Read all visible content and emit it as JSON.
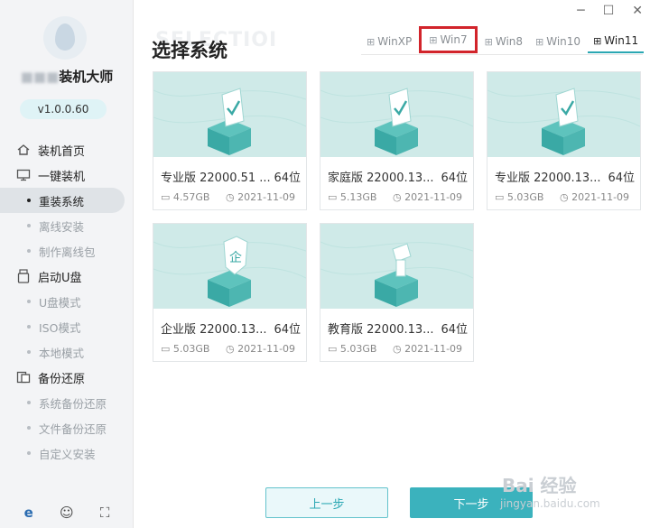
{
  "app": {
    "brand_blur": "■■■",
    "brand_name": "装机大师",
    "version": "v1.0.0.60"
  },
  "window_controls": {
    "minimize": "─",
    "maximize": "☐",
    "close": "✕"
  },
  "sidebar": {
    "groups": [
      {
        "label": "装机首页",
        "icon": "home-icon"
      },
      {
        "label": "一键装机",
        "icon": "monitor-icon"
      },
      {
        "label": "启动U盘",
        "icon": "usb-icon"
      },
      {
        "label": "备份还原",
        "icon": "backup-icon"
      }
    ],
    "sub_install": [
      "重装系统",
      "离线安装",
      "制作离线包"
    ],
    "sub_usb": [
      "U盘模式",
      "ISO模式",
      "本地模式"
    ],
    "sub_backup": [
      "系统备份还原",
      "文件备份还原",
      "自定义安装"
    ],
    "footer": [
      "e",
      "☺",
      "⛶"
    ]
  },
  "main": {
    "bg_word": "SELECTIOI",
    "title": "选择系统",
    "tabs": [
      "WinXP",
      "Win7",
      "Win8",
      "Win10",
      "Win11"
    ],
    "active_tab": "Win11",
    "highlight_tab": "Win7"
  },
  "cards": [
    {
      "name": "专业版 22000.51 ...",
      "bits": "64位",
      "size": "4.57GB",
      "date": "2021-11-09",
      "emblem": "check"
    },
    {
      "name": "家庭版 22000.13...",
      "bits": "64位",
      "size": "5.13GB",
      "date": "2021-11-09",
      "emblem": "check"
    },
    {
      "name": "专业版 22000.13...",
      "bits": "64位",
      "size": "5.03GB",
      "date": "2021-11-09",
      "emblem": "check"
    },
    {
      "name": "企业版 22000.13...",
      "bits": "64位",
      "size": "5.03GB",
      "date": "2021-11-09",
      "emblem": "企"
    },
    {
      "name": "教育版 22000.13...",
      "bits": "64位",
      "size": "5.03GB",
      "date": "2021-11-09",
      "emblem": "edu"
    }
  ],
  "buttons": {
    "prev": "上一步",
    "next": "下一步"
  },
  "watermark": {
    "main": "Bai 经验",
    "sub": "jingyan.baidu.com"
  },
  "colors": {
    "accent": "#2aa7b3",
    "highlight_box": "#d2242b",
    "card_image_bg": "#cfeae8"
  }
}
